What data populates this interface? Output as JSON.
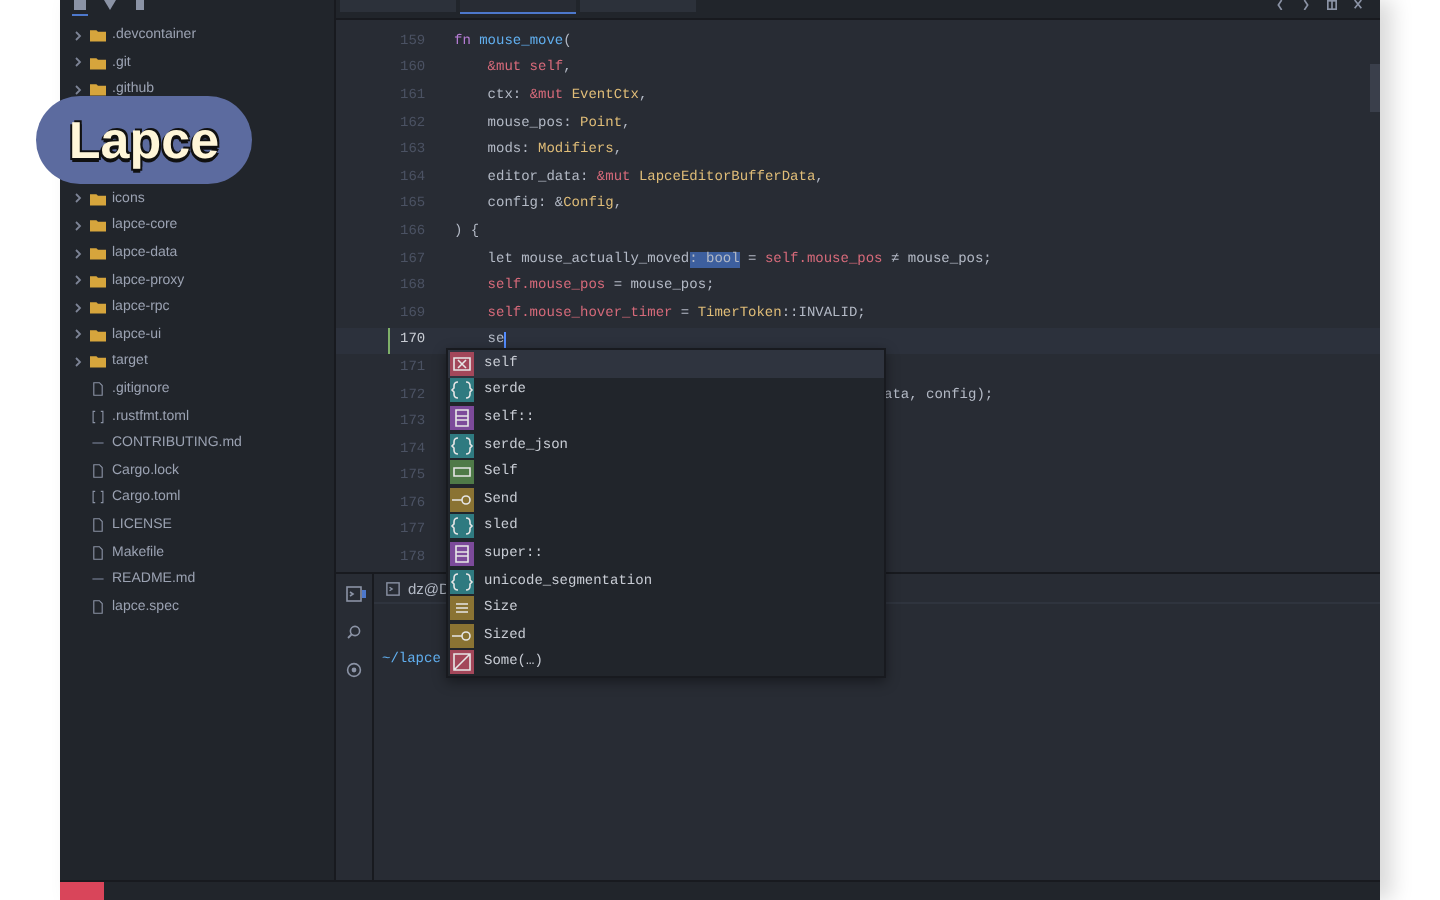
{
  "logo": {
    "text": "Lapce"
  },
  "sidebar": {
    "items": [
      {
        "name": ".devcontainer",
        "kind": "folder",
        "expanded": false
      },
      {
        "name": ".git",
        "kind": "folder",
        "expanded": false
      },
      {
        "name": ".github",
        "kind": "folder",
        "expanded": false
      },
      {
        "name": "icons",
        "kind": "folder",
        "expanded": false
      },
      {
        "name": "lapce-core",
        "kind": "folder",
        "expanded": false
      },
      {
        "name": "lapce-data",
        "kind": "folder",
        "expanded": false
      },
      {
        "name": "lapce-proxy",
        "kind": "folder",
        "expanded": false
      },
      {
        "name": "lapce-rpc",
        "kind": "folder",
        "expanded": false
      },
      {
        "name": "lapce-ui",
        "kind": "folder",
        "expanded": false
      },
      {
        "name": "target",
        "kind": "folder",
        "expanded": false
      },
      {
        "name": ".gitignore",
        "kind": "file"
      },
      {
        "name": ".rustfmt.toml",
        "kind": "config"
      },
      {
        "name": "CONTRIBUTING.md",
        "kind": "markdown"
      },
      {
        "name": "Cargo.lock",
        "kind": "file"
      },
      {
        "name": "Cargo.toml",
        "kind": "config"
      },
      {
        "name": "LICENSE",
        "kind": "file"
      },
      {
        "name": "Makefile",
        "kind": "file"
      },
      {
        "name": "README.md",
        "kind": "markdown"
      },
      {
        "name": "lapce.spec",
        "kind": "file"
      }
    ]
  },
  "editor_tabs": [
    {
      "selected": false
    },
    {
      "selected": true
    },
    {
      "selected": false
    }
  ],
  "editor": {
    "lines": [
      {
        "number": "159",
        "kind": "code",
        "current": false,
        "modified": false,
        "tokens": [
          {
            "text": "fn ",
            "kind": "keyword"
          },
          {
            "text": "mouse_move",
            "kind": "function"
          },
          {
            "text": "(",
            "kind": "plain"
          }
        ]
      },
      {
        "number": "160",
        "kind": "code",
        "current": false,
        "modified": false,
        "tokens": [
          {
            "text": "    &mut self",
            "kind": "self"
          },
          {
            "text": ",",
            "kind": "plain"
          }
        ]
      },
      {
        "number": "161",
        "kind": "code",
        "current": false,
        "modified": false,
        "tokens": [
          {
            "text": "    ctx: ",
            "kind": "plain"
          },
          {
            "text": "&mut ",
            "kind": "self"
          },
          {
            "text": "EventCtx",
            "kind": "type"
          },
          {
            "text": ",",
            "kind": "plain"
          }
        ]
      },
      {
        "number": "162",
        "kind": "code",
        "current": false,
        "modified": false,
        "tokens": [
          {
            "text": "    mouse_pos: ",
            "kind": "plain"
          },
          {
            "text": "Point",
            "kind": "type"
          },
          {
            "text": ",",
            "kind": "plain"
          }
        ]
      },
      {
        "number": "163",
        "kind": "code",
        "current": false,
        "modified": false,
        "tokens": [
          {
            "text": "    mods: ",
            "kind": "plain"
          },
          {
            "text": "Modifiers",
            "kind": "type"
          },
          {
            "text": ",",
            "kind": "plain"
          }
        ]
      },
      {
        "number": "164",
        "kind": "code",
        "current": false,
        "modified": false,
        "tokens": [
          {
            "text": "    editor_data: ",
            "kind": "plain"
          },
          {
            "text": "&mut ",
            "kind": "self"
          },
          {
            "text": "LapceEditorBufferData",
            "kind": "type"
          },
          {
            "text": ",",
            "kind": "plain"
          }
        ]
      },
      {
        "number": "165",
        "kind": "code",
        "current": false,
        "modified": false,
        "tokens": [
          {
            "text": "    config: &",
            "kind": "plain"
          },
          {
            "text": "Config",
            "kind": "type"
          },
          {
            "text": ",",
            "kind": "plain"
          }
        ]
      },
      {
        "number": "166",
        "kind": "code",
        "current": false,
        "modified": false,
        "tokens": [
          {
            "text": ") {",
            "kind": "plain"
          }
        ]
      },
      {
        "number": "167",
        "kind": "code",
        "current": false,
        "modified": false,
        "tokens": [
          {
            "text": "    let mouse_actually_moved",
            "kind": "plain"
          },
          {
            "text": ": bool",
            "kind": "selection"
          },
          {
            "text": " = ",
            "kind": "plain"
          },
          {
            "text": "self.mouse_pos",
            "kind": "self"
          },
          {
            "text": " ≠ mouse_pos;",
            "kind": "plain"
          }
        ]
      },
      {
        "number": "168",
        "kind": "code",
        "current": false,
        "modified": false,
        "tokens": [
          {
            "text": "    self.mouse_pos",
            "kind": "self"
          },
          {
            "text": " = mouse_pos;",
            "kind": "plain"
          }
        ]
      },
      {
        "number": "169",
        "kind": "code",
        "current": false,
        "modified": false,
        "tokens": [
          {
            "text": "    self.mouse_hover_timer",
            "kind": "self"
          },
          {
            "text": " = ",
            "kind": "plain"
          },
          {
            "text": "TimerToken",
            "kind": "type"
          },
          {
            "text": "::INVALID;",
            "kind": "plain"
          }
        ]
      },
      {
        "number": "170",
        "kind": "code",
        "current": true,
        "modified": true,
        "tokens": [
          {
            "text": "    se",
            "kind": "plain"
          }
        ]
      },
      {
        "number": "171",
        "current": false,
        "modified": false
      },
      {
        "number": "172",
        "kind": "partial",
        "current": false,
        "modified": false,
        "tokens": [
          {
            "text": "ata, config);",
            "kind": "plain"
          }
        ]
      },
      {
        "number": "173",
        "current": false,
        "modified": false
      },
      {
        "number": "174",
        "current": false,
        "modified": false
      },
      {
        "number": "175",
        "current": false,
        "modified": false
      },
      {
        "number": "176",
        "current": false,
        "modified": false
      },
      {
        "number": "177",
        "current": false,
        "modified": false
      },
      {
        "number": "178",
        "current": false,
        "modified": false
      }
    ]
  },
  "completion": {
    "items": [
      {
        "label": "self",
        "kind": "variable",
        "selected": true
      },
      {
        "label": "serde",
        "kind": "module",
        "selected": false
      },
      {
        "label": "self::",
        "kind": "keyword",
        "selected": false
      },
      {
        "label": "serde_json",
        "kind": "module",
        "selected": false
      },
      {
        "label": "Self",
        "kind": "struct",
        "selected": false
      },
      {
        "label": "Send",
        "kind": "trait",
        "selected": false
      },
      {
        "label": "sled",
        "kind": "module",
        "selected": false
      },
      {
        "label": "super::",
        "kind": "keyword",
        "selected": false
      },
      {
        "label": "unicode_segmentation",
        "kind": "module",
        "selected": false
      },
      {
        "label": "Size",
        "kind": "typeparam",
        "selected": false
      },
      {
        "label": "Sized",
        "kind": "trait",
        "selected": false
      },
      {
        "label": "Some(…)",
        "kind": "variant",
        "selected": false
      }
    ]
  },
  "panel": {
    "terminal_tab": "dz@D",
    "prompt": "~/lapce"
  }
}
